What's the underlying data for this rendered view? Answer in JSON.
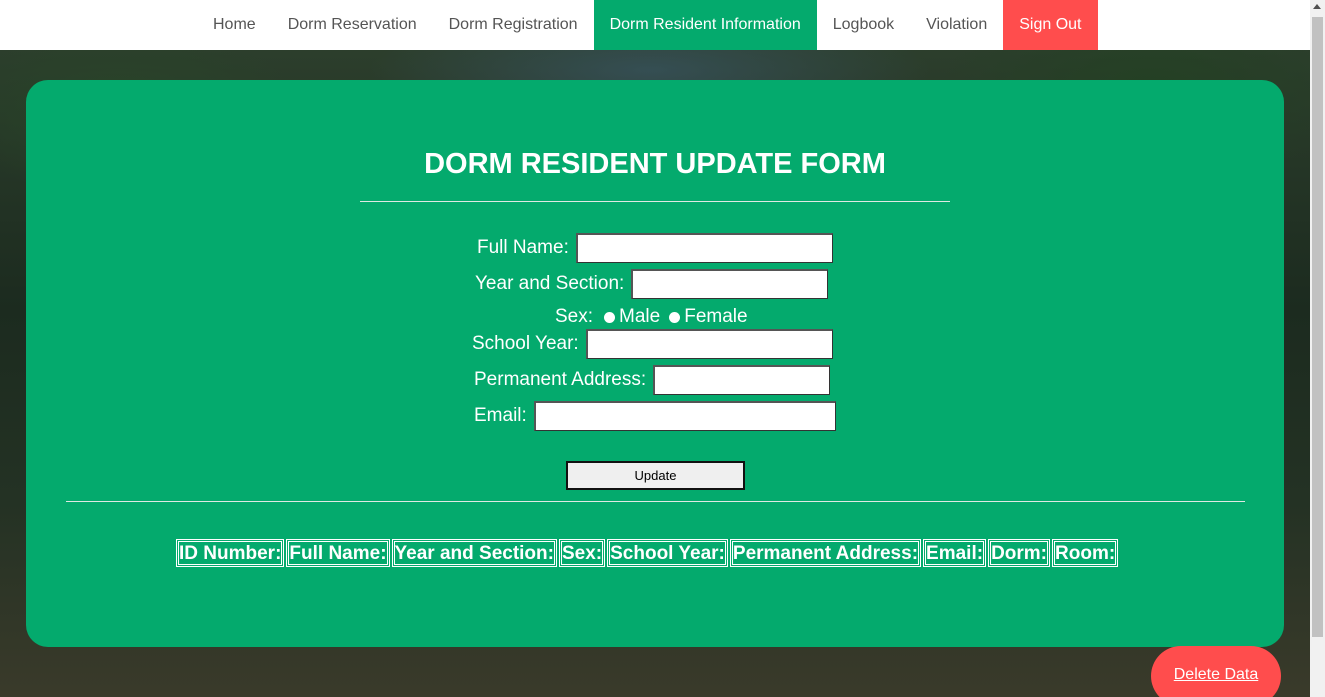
{
  "nav": {
    "items": [
      {
        "label": "Home",
        "state": "normal"
      },
      {
        "label": "Dorm Reservation",
        "state": "normal"
      },
      {
        "label": "Dorm Registration",
        "state": "normal"
      },
      {
        "label": "Dorm Resident Information",
        "state": "active"
      },
      {
        "label": "Logbook",
        "state": "normal"
      },
      {
        "label": "Violation",
        "state": "normal"
      },
      {
        "label": "Sign Out",
        "state": "danger"
      }
    ]
  },
  "form": {
    "title": "DORM RESIDENT UPDATE FORM",
    "fields": {
      "full_name": {
        "label": "Full Name:",
        "value": ""
      },
      "year_section": {
        "label": "Year and Section:",
        "value": ""
      },
      "sex": {
        "label": "Sex:",
        "options": [
          "Male",
          "Female"
        ]
      },
      "school_year": {
        "label": "School Year:",
        "value": ""
      },
      "address": {
        "label": "Permanent Address:",
        "value": ""
      },
      "email": {
        "label": "Email:",
        "value": ""
      }
    },
    "update_label": "Update"
  },
  "table": {
    "headers": [
      "ID Number:",
      "Full Name:",
      "Year and Section:",
      "Sex:",
      "School Year:",
      "Permanent Address:",
      "Email:",
      "Dorm:",
      "Room:"
    ]
  },
  "delete_label": "Delete Data",
  "colors": {
    "accent": "#04aa6d",
    "danger": "#ff4d4d",
    "nav_text": "#555555"
  }
}
